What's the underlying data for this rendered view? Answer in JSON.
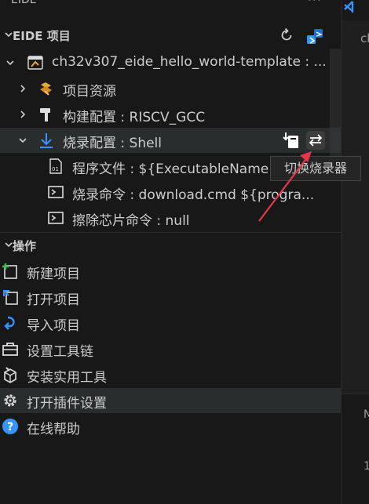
{
  "topbar": {
    "title": "EIDE",
    "more": "···"
  },
  "project_panel": {
    "title": "EIDE 项目",
    "project": "ch32v307_eide_hello_world-template : ...",
    "items": [
      {
        "label": "项目资源"
      },
      {
        "label": "构建配置 : RISCV_GCC"
      },
      {
        "label": "烧录配置 : Shell"
      }
    ],
    "flash_children": [
      {
        "label": "程序文件 : ${ExecutableName"
      },
      {
        "label": "烧录命令 : download.cmd ${progra..."
      },
      {
        "label": "擦除芯片命令 : null"
      }
    ]
  },
  "tooltip": {
    "text": "切换烧录器"
  },
  "operations_panel": {
    "title": "操作",
    "items": [
      {
        "label": "新建项目",
        "icon": "new-project-icon"
      },
      {
        "label": "打开项目",
        "icon": "open-project-icon"
      },
      {
        "label": "导入项目",
        "icon": "import-project-icon"
      },
      {
        "label": "设置工具链",
        "icon": "toolbox-icon"
      },
      {
        "label": "安装实用工具",
        "icon": "install-tool-icon"
      },
      {
        "label": "打开插件设置",
        "icon": "gear-icon"
      },
      {
        "label": "在线帮助",
        "icon": "help-icon"
      }
    ]
  },
  "editor_strip": {
    "tab_text": "ch",
    "bottom_a": "N",
    "bottom_b": "1"
  },
  "colors": {
    "background": "#181818",
    "selected_row": "#2a2d2e",
    "arrow": "#e5364a",
    "accent_blue": "#3794ff"
  }
}
